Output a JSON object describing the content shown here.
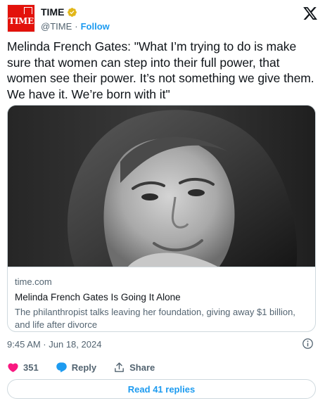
{
  "account": {
    "avatar_text": "TIME",
    "name": "TIME",
    "handle": "@TIME",
    "separator": "·",
    "follow_label": "Follow",
    "brand_color": "#e3120b",
    "verified_color": "#e2b719",
    "verified_icon": "verified-gold-badge-icon"
  },
  "tweet": {
    "text": "Melinda French Gates: \"What I’m trying to do is make sure that women can step into their full power, that women see their power. It’s not something we give them. We have it. We’re born with it\"",
    "timestamp": "9:45 AM · Jun 18, 2024"
  },
  "link_card": {
    "image": "black-and-white portrait photo",
    "domain": "time.com",
    "title": "Melinda French Gates Is Going It Alone",
    "description": "The philanthropist talks leaving her foundation, giving away $1 billion, and life after divorce"
  },
  "actions": {
    "like_count": "351",
    "reply_label": "Reply",
    "share_label": "Share",
    "like_color": "#f91880",
    "accent_color": "#1d9bf0"
  },
  "read_replies_label": "Read 41 replies",
  "icons": {
    "platform": "x-logo-icon",
    "info": "info-icon",
    "like": "heart-icon",
    "reply": "speech-bubble-icon",
    "share": "upload-share-icon"
  }
}
